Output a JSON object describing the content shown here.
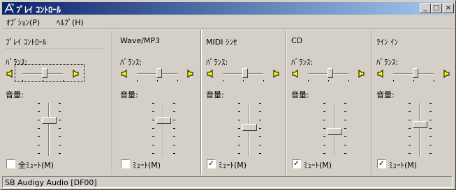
{
  "window": {
    "title": "ﾌﾟﾚｲ ｺﾝﾄﾛｰﾙ",
    "controls": {
      "minimize": "_",
      "maximize": "□",
      "close": "×"
    }
  },
  "menu": [
    "ｵﾌﾟｼｮﾝ(P)",
    "ﾍﾙﾌﾟ(H)"
  ],
  "labels": {
    "balance": "ﾊﾞﾗﾝｽ:",
    "volume": "音量:"
  },
  "columns": [
    {
      "title": "ﾌﾟﾚｲ ｺﾝﾄﾛｰﾙ",
      "mute_label": "全ﾐｭｰﾄ(M)",
      "muted": false,
      "balance": 0.55,
      "volume": 0.3
    },
    {
      "title": "Wave/MP3",
      "mute_label": "ﾐｭｰﾄ(M)",
      "muted": false,
      "balance": 0.55,
      "volume": 0.3
    },
    {
      "title": "MIDI ｼﾝｾ",
      "mute_label": "ﾐｭｰﾄ(M)",
      "muted": true,
      "balance": 0.55,
      "volume": 0.45
    },
    {
      "title": "CD",
      "mute_label": "ﾐｭｰﾄ(M)",
      "muted": true,
      "balance": 0.55,
      "volume": 0.55
    },
    {
      "title": "ﾗｲﾝ ｲﾝ",
      "mute_label": "ﾐｭｰﾄ(M)",
      "muted": true,
      "balance": 0.55,
      "volume": 0.4
    }
  ],
  "status": "SB Audigy Audio [DF00]",
  "icons": {
    "app": "mixer-icon",
    "speaker_left": "speaker-left-icon",
    "speaker_right": "speaker-right-icon"
  },
  "colors": {
    "titlebar_start": "#0a246a",
    "titlebar_end": "#a6caf0",
    "face": "#d4d0c8",
    "speaker": "#ffff00"
  }
}
